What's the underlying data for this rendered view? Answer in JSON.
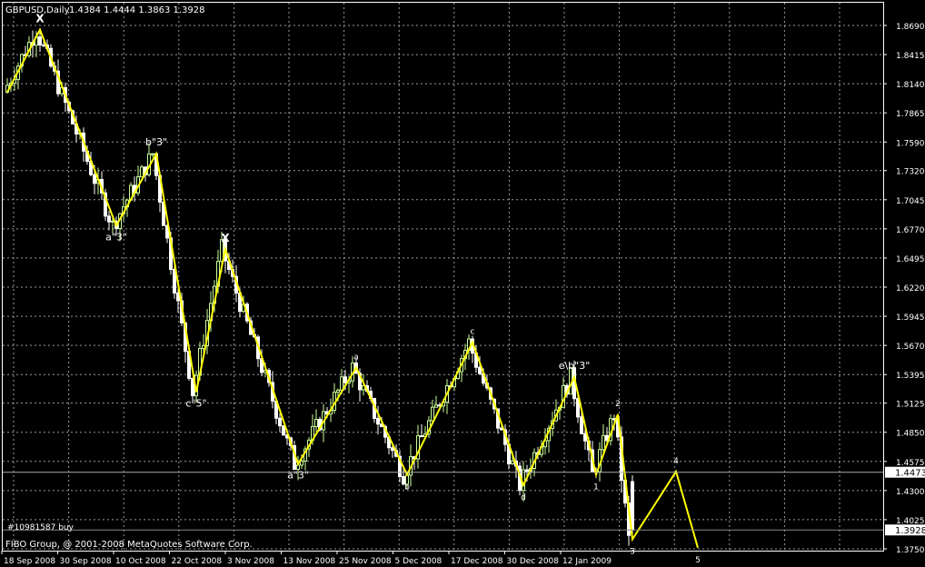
{
  "header": {
    "symbol_timeframe": "GBPUSD,Daily",
    "ohlc": "1.4384 1.4444 1.3863 1.3928"
  },
  "order_label": "#10981587 buy",
  "copyright": "FIBO Group, @ 2001-2008 MetaQuotes Software Corp.",
  "colors": {
    "background": "#000000",
    "axes": "#ffffff",
    "grid": "#9a9a9a",
    "up_candle": "#ccff99",
    "down_candle": "#ffffff",
    "wave_line": "#ffff00",
    "order_line": "#aaaaaa"
  },
  "current_price_label": "1.3928",
  "order_price_label": "1.4473",
  "chart_data": {
    "type": "candlestick",
    "y_ticks": [
      "1.8690",
      "1.8415",
      "1.8140",
      "1.7865",
      "1.7590",
      "1.7320",
      "1.7045",
      "1.6770",
      "1.6495",
      "1.6220",
      "1.5945",
      "1.5670",
      "1.5395",
      "1.5125",
      "1.4850",
      "1.4575",
      "1.4300",
      "1.4025",
      "1.3750"
    ],
    "x_ticks": [
      "18 Sep 2008",
      "30 Sep 2008",
      "10 Oct 2008",
      "22 Oct 2008",
      "3 Nov 2008",
      "13 Nov 2008",
      "25 Nov 2008",
      "5 Dec 2008",
      "17 Dec 2008",
      "30 Dec 2008",
      "12 Jan 2009"
    ],
    "ylim": [
      1.37,
      1.885
    ],
    "last_bar": {
      "open": 1.4384,
      "high": 1.4444,
      "low": 1.3863,
      "close": 1.3928
    },
    "order_price": 1.4473,
    "wave_points": [
      {
        "bar": 0,
        "price": 1.806,
        "label": ""
      },
      {
        "bar": 9,
        "price": 1.865,
        "label": "X"
      },
      {
        "bar": 30,
        "price": 1.68,
        "label": "a\"3\""
      },
      {
        "bar": 41,
        "price": 1.748,
        "label": "b\"3\""
      },
      {
        "bar": 52,
        "price": 1.523,
        "label": "c\"5\""
      },
      {
        "bar": 60,
        "price": 1.658,
        "label": "X"
      },
      {
        "bar": 80,
        "price": 1.455,
        "label": "a\"3\""
      },
      {
        "bar": 96,
        "price": 1.546,
        "label": "a"
      },
      {
        "bar": 110,
        "price": 1.445,
        "label": "b"
      },
      {
        "bar": 128,
        "price": 1.57,
        "label": "c"
      },
      {
        "bar": 142,
        "price": 1.435,
        "label": "d"
      },
      {
        "bar": 156,
        "price": 1.537,
        "label": "e\\b\"3\""
      },
      {
        "bar": 162,
        "price": 1.445,
        "label": "1"
      },
      {
        "bar": 168,
        "price": 1.502,
        "label": "2"
      },
      {
        "bar": 172,
        "price": 1.384,
        "label": "3"
      },
      {
        "bar": 184,
        "price": 1.448,
        "label": "4"
      },
      {
        "bar": 190,
        "price": 1.376,
        "label": "5"
      }
    ]
  }
}
